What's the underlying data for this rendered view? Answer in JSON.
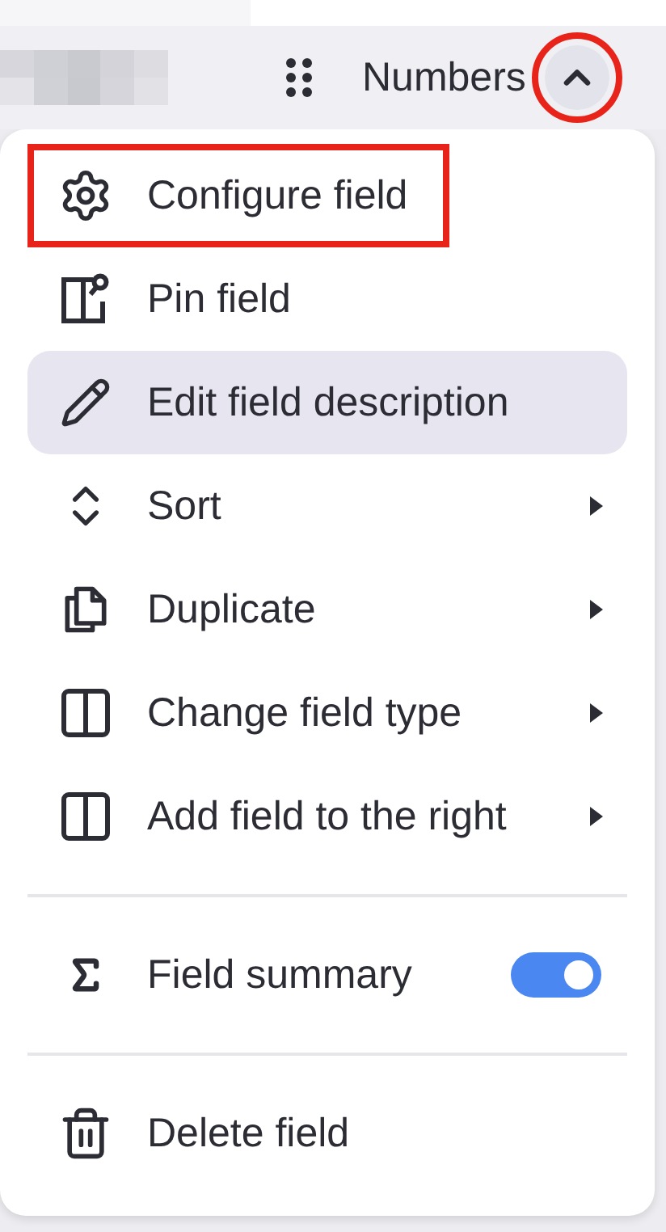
{
  "header": {
    "label": "Numbers",
    "menu_button": {
      "expanded": true,
      "annotated": true
    }
  },
  "menu": {
    "sections": [
      {
        "items": [
          {
            "kind": "action",
            "label": "Configure field",
            "selected": false,
            "annotated": true
          },
          {
            "kind": "action",
            "label": "Pin field",
            "selected": false,
            "annotated": false
          },
          {
            "kind": "action",
            "label": "Edit field description",
            "selected": true,
            "annotated": false
          },
          {
            "kind": "submenu",
            "label": "Sort",
            "selected": false,
            "annotated": false
          },
          {
            "kind": "submenu",
            "label": "Duplicate",
            "selected": false,
            "annotated": false
          },
          {
            "kind": "submenu",
            "label": "Change field type",
            "selected": false,
            "annotated": false
          },
          {
            "kind": "submenu",
            "label": "Add field to the right",
            "selected": false,
            "annotated": false
          }
        ]
      },
      {
        "items": [
          {
            "kind": "toggle",
            "label": "Field summary",
            "selected": false,
            "annotated": false,
            "on": true
          }
        ]
      },
      {
        "items": [
          {
            "kind": "action",
            "label": "Delete field",
            "selected": false,
            "annotated": false
          }
        ]
      }
    ]
  }
}
